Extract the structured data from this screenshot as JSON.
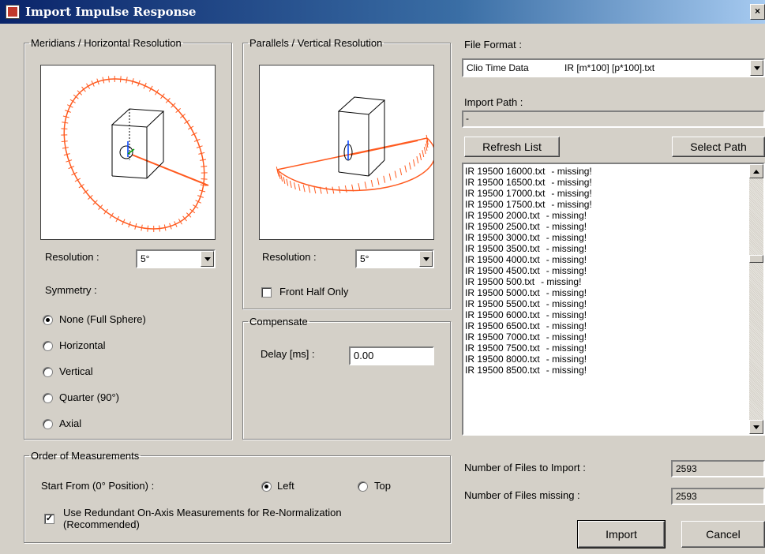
{
  "window": {
    "title": "Import Impulse Response",
    "close_label": "×"
  },
  "meridians": {
    "legend": "Meridians / Horizontal Resolution",
    "resolution_label": "Resolution :",
    "resolution_value": "5°",
    "symmetry_label": "Symmetry :",
    "symmetry_options": [
      "None (Full Sphere)",
      "Horizontal",
      "Vertical",
      "Quarter (90°)",
      "Axial"
    ],
    "symmetry_selected": "None (Full Sphere)"
  },
  "parallels": {
    "legend": "Parallels / Vertical Resolution",
    "resolution_label": "Resolution :",
    "resolution_value": "5°",
    "front_half_label": "Front Half Only",
    "front_half_checked": false
  },
  "compensate": {
    "legend": "Compensate",
    "delay_label": "Delay [ms] :",
    "delay_value": "0.00"
  },
  "file": {
    "format_label": "File Format :",
    "format_value_name": "Clio Time Data",
    "format_value_pattern": "IR [m*100] [p*100].txt",
    "path_label": "Import Path :",
    "path_value": "-",
    "refresh_label": "Refresh List",
    "select_path_label": "Select Path",
    "list": [
      {
        "file": "IR 19500 16000.txt",
        "status": "- missing!"
      },
      {
        "file": "IR 19500 16500.txt",
        "status": "- missing!"
      },
      {
        "file": "IR 19500 17000.txt",
        "status": "- missing!"
      },
      {
        "file": "IR 19500 17500.txt",
        "status": "- missing!"
      },
      {
        "file": "IR 19500 2000.txt",
        "status": "- missing!"
      },
      {
        "file": "IR 19500 2500.txt",
        "status": "- missing!"
      },
      {
        "file": "IR 19500 3000.txt",
        "status": "- missing!"
      },
      {
        "file": "IR 19500 3500.txt",
        "status": "- missing!"
      },
      {
        "file": "IR 19500 4000.txt",
        "status": "- missing!"
      },
      {
        "file": "IR 19500 4500.txt",
        "status": "- missing!"
      },
      {
        "file": "IR 19500 500.txt",
        "status": "- missing!"
      },
      {
        "file": "IR 19500 5000.txt",
        "status": "- missing!"
      },
      {
        "file": "IR 19500 5500.txt",
        "status": "- missing!"
      },
      {
        "file": "IR 19500 6000.txt",
        "status": "- missing!"
      },
      {
        "file": "IR 19500 6500.txt",
        "status": "- missing!"
      },
      {
        "file": "IR 19500 7000.txt",
        "status": "- missing!"
      },
      {
        "file": "IR 19500 7500.txt",
        "status": "- missing!"
      },
      {
        "file": "IR 19500 8000.txt",
        "status": "- missing!"
      },
      {
        "file": "IR 19500 8500.txt",
        "status": "- missing!"
      }
    ]
  },
  "order": {
    "legend": "Order of Measurements",
    "start_label": "Start From (0° Position) :",
    "left_label": "Left",
    "top_label": "Top",
    "start_selected": "Left",
    "redundant_label_line1": "Use Redundant On-Axis Measurements for Re-Normalization",
    "redundant_label_line2": "(Recommended)",
    "redundant_checked": true
  },
  "counts": {
    "to_import_label": "Number of Files to Import :",
    "to_import_value": "2593",
    "missing_label": "Number of Files missing :",
    "missing_value": "2593"
  },
  "actions": {
    "import_label": "Import",
    "cancel_label": "Cancel"
  },
  "colors": {
    "title_start": "#0a246a",
    "title_end": "#a6caf0",
    "grid_orange": "#ff5a1f",
    "face": "#d4d0c8"
  }
}
